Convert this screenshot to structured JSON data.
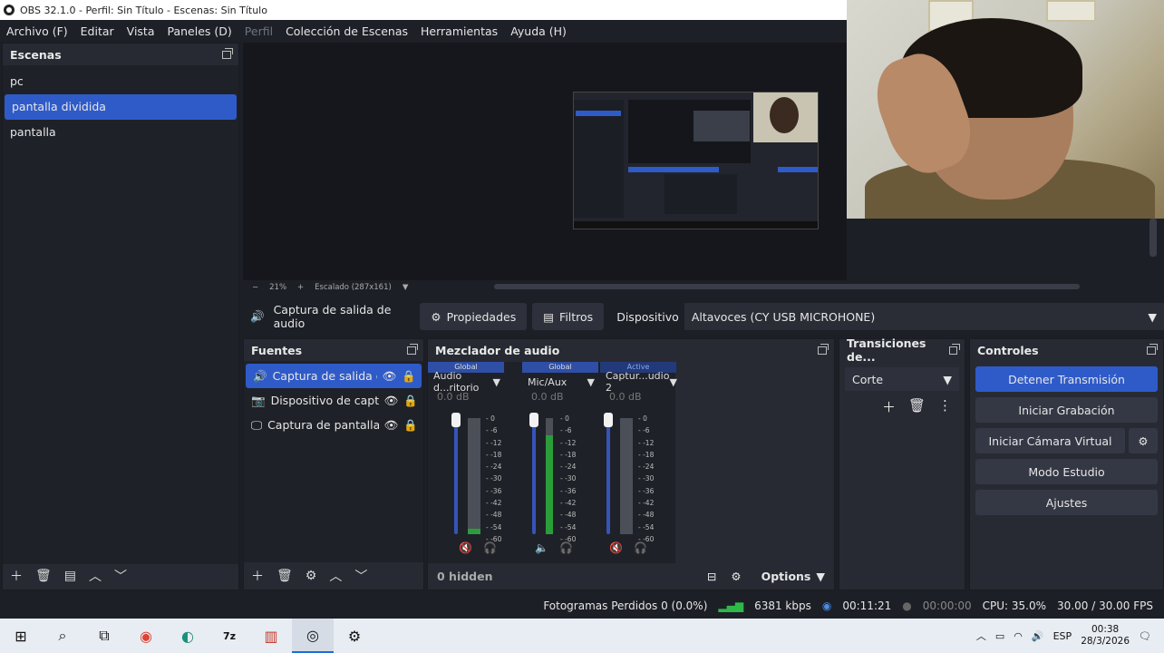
{
  "window": {
    "title": "OBS 32.1.0 - Perfil: Sin Título - Escenas: Sin Título"
  },
  "menu": [
    "Archivo (F)",
    "Editar",
    "Vista",
    "Paneles (D)",
    "Perfil",
    "Colección de Escenas",
    "Herramientas",
    "Ayuda (H)"
  ],
  "scenes": {
    "title": "Escenas",
    "items": [
      "pc",
      "pantalla dividida",
      "pantalla"
    ],
    "selected": "pantalla dividida"
  },
  "preview": {
    "zoom": "21%",
    "scale_label": "Escalado (287x161)"
  },
  "context": {
    "source_label": "Captura de salida de audio",
    "properties": "Propiedades",
    "filters": "Filtros",
    "device_label": "Dispositivo",
    "device_value": "Altavoces (CY USB MICROHONE)"
  },
  "sources": {
    "title": "Fuentes",
    "items": [
      {
        "name": "Captura de salida de",
        "icon": "speaker-icon"
      },
      {
        "name": "Dispositivo de captu",
        "icon": "camera-icon"
      },
      {
        "name": "Captura de pantalla",
        "icon": "monitor-icon"
      }
    ]
  },
  "mixer": {
    "title": "Mezclador de audio",
    "channels": [
      {
        "tag": "Global",
        "name": "Audio d...ritorio",
        "db": "0.0 dB",
        "level": 0.05
      },
      {
        "tag": "Global",
        "name": "Mic/Aux",
        "db": "0.0 dB",
        "level": 0.85
      },
      {
        "tag": "Active",
        "name": "Captur...udio 2",
        "db": "0.0 dB",
        "level": 0.0
      }
    ],
    "ticks": [
      "0",
      "-6",
      "-12",
      "-18",
      "-24",
      "-30",
      "-36",
      "-42",
      "-48",
      "-54",
      "-60"
    ],
    "hidden": "0 hidden",
    "options": "Options"
  },
  "transitions": {
    "title": "Transiciones de...",
    "selected": "Corte"
  },
  "controls": {
    "title": "Controles",
    "stop_stream": "Detener Transmisión",
    "start_recording": "Iniciar Grabación",
    "virtual_cam": "Iniciar Cámara Virtual",
    "studio_mode": "Modo Estudio",
    "settings": "Ajustes"
  },
  "status": {
    "dropped": "Fotogramas Perdidos 0 (0.0%)",
    "bitrate": "6381 kbps",
    "stream_time": "00:11:21",
    "rec_time": "00:00:00",
    "cpu": "CPU: 35.0%",
    "fps": "30.00 / 30.00 FPS"
  },
  "taskbar": {
    "lang": "ESP",
    "time": "00:38",
    "date": "28/3/2026"
  }
}
